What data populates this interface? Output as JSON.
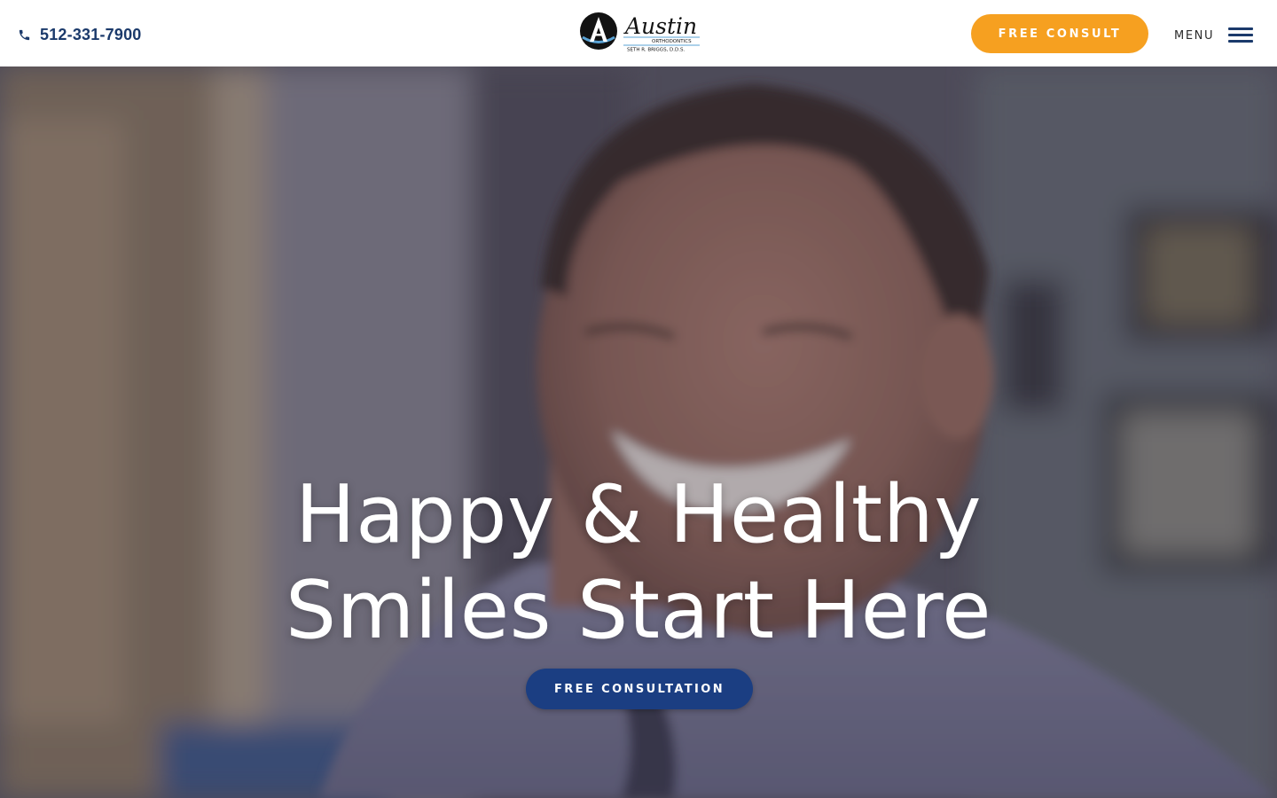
{
  "header": {
    "phone": {
      "icon": "phone-icon",
      "number": "512-331-7900"
    },
    "logo": {
      "script_text": "Austin",
      "subtitle": "ORTHODONTICS",
      "doctor": "SETH R. BRIGGS, D.D.S."
    },
    "consult_button_label": "FREE CONSULT",
    "menu_label": "MENU",
    "menu_icon": "hamburger-menu-icon"
  },
  "hero": {
    "title_line_1": "Happy & Healthy",
    "title_line_2": "Smiles Start Here",
    "cta_label": "FREE CONSULTATION",
    "background": "photo-of-smiling-orthodontist-in-office"
  },
  "colors": {
    "brand_navy": "#1b3a6b",
    "cta_navy": "#1b3e82",
    "accent_orange": "#f6a020",
    "logo_blue": "#5aa3d6"
  }
}
